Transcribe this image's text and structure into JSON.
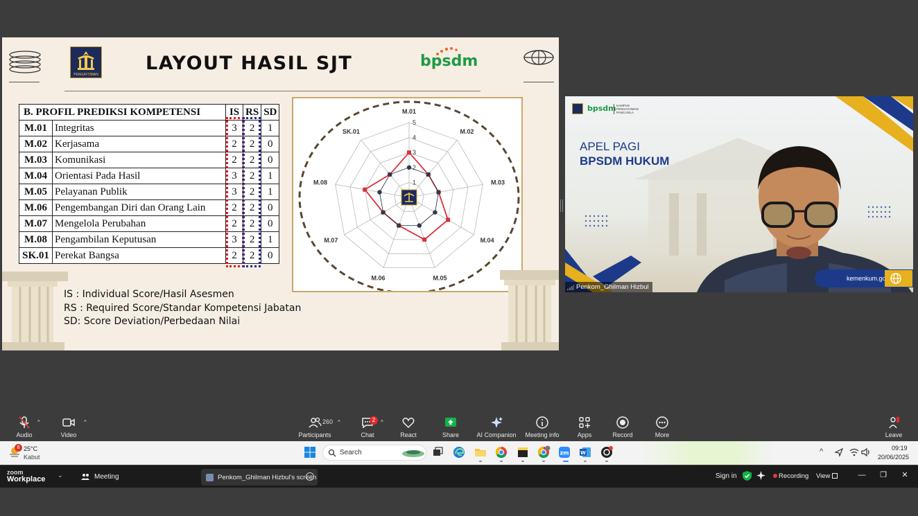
{
  "slide": {
    "title": "LAYOUT HASIL SJT",
    "brand": "bpsdm",
    "logo_caption": "PENGAYOMAN",
    "table": {
      "heading": "B. PROFIL PREDIKSI KOMPETENSI",
      "col_is": "IS",
      "col_rs": "RS",
      "col_sd": "SD",
      "rows": [
        {
          "code": "M.01",
          "name": "Integritas",
          "is": "3",
          "rs": "2",
          "sd": "1"
        },
        {
          "code": "M.02",
          "name": "Kerjasama",
          "is": "2",
          "rs": "2",
          "sd": "0"
        },
        {
          "code": "M.03",
          "name": "Komunikasi",
          "is": "2",
          "rs": "2",
          "sd": "0"
        },
        {
          "code": "M.04",
          "name": "Orientasi Pada Hasil",
          "is": "3",
          "rs": "2",
          "sd": "1"
        },
        {
          "code": "M.05",
          "name": "Pelayanan Publik",
          "is": "3",
          "rs": "2",
          "sd": "1"
        },
        {
          "code": "M.06",
          "name": "Pengembangan Diri dan Orang Lain",
          "is": "2",
          "rs": "2",
          "sd": "0"
        },
        {
          "code": "M.07",
          "name": "Mengelola Perubahan",
          "is": "2",
          "rs": "2",
          "sd": "0"
        },
        {
          "code": "M.08",
          "name": "Pengambilan Keputusan",
          "is": "3",
          "rs": "2",
          "sd": "1"
        },
        {
          "code": "SK.01",
          "name": "Perekat Bangsa",
          "is": "2",
          "rs": "2",
          "sd": "0"
        }
      ]
    },
    "notes": [
      "IS : Individual Score/Hasil Asesmen",
      "RS : Required Score/Standar Kompetensi Jabatan",
      "SD: Score Deviation/Perbedaan Nilai"
    ]
  },
  "chart_data": {
    "type": "radar",
    "categories": [
      "M.01",
      "M.02",
      "M.03",
      "M.04",
      "M.05",
      "M.06",
      "M.07",
      "M.08",
      "SK.01"
    ],
    "rlim": [
      0,
      5
    ],
    "ticks": [
      "1",
      "2",
      "3",
      "4",
      "5"
    ],
    "series": [
      {
        "values": [
          3,
          2,
          2,
          3,
          3,
          2,
          2,
          3,
          2
        ],
        "color": "#d8323a"
      },
      {
        "values": [
          2,
          2,
          2,
          2,
          2,
          2,
          2,
          2,
          2
        ],
        "color": "#2f3a4a"
      }
    ]
  },
  "video": {
    "heading_line1": "APEL PAGI",
    "heading_line2": "BPSDM HUKUM",
    "brand": "bpsdm",
    "brand_sub": "KAMPUS PENGAYOMAN PANCASILA",
    "url": "kemenkum.go.id",
    "participant_name": "Penkom_Ghilman Hizbul"
  },
  "toolbar": {
    "audio": "Audio",
    "video": "Video",
    "participants": "Participants",
    "participants_count": "260",
    "chat": "Chat",
    "chat_badge": "2",
    "react": "React",
    "share": "Share",
    "ai_companion": "AI Companion",
    "meeting_info": "Meeting info",
    "apps": "Apps",
    "record": "Record",
    "more": "More",
    "leave": "Leave"
  },
  "taskbar": {
    "weather_temp": "25°C",
    "weather_desc": "Kabut",
    "weather_badge": "6",
    "search_placeholder": "Search",
    "time": "09:19",
    "date": "20/06/2025"
  },
  "bottom_bar": {
    "brand_top": "zoom",
    "brand_bottom": "Workplace",
    "meeting": "Meeting",
    "screen_tab": "Penkom_Ghilman Hizbul's screen",
    "sign_in": "Sign in",
    "recording": "Recording",
    "view": "View"
  },
  "colors": {
    "accent_green": "#1f9a44",
    "share_green": "#13b24a",
    "navy": "#1d3a8a",
    "recording_red": "#e53935"
  }
}
